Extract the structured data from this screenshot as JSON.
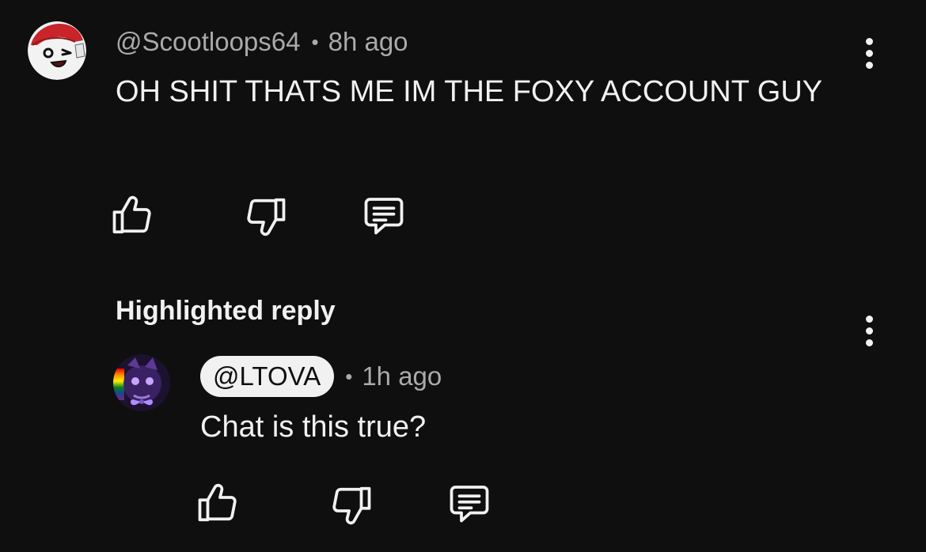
{
  "comment": {
    "author": "@Scootloops64",
    "separator": "•",
    "time": "8h ago",
    "text": "OH SHIT THATS ME IM THE FOXY ACCOUNT GUY",
    "actions": {
      "like_icon": "thumbs-up-icon",
      "dislike_icon": "thumbs-down-icon",
      "reply_icon": "reply-comment-icon"
    },
    "menu_icon": "more-vertical-icon"
  },
  "highlighted_reply": {
    "label": "Highlighted reply",
    "author": "@LTOVA",
    "separator": "•",
    "time": "1h ago",
    "text": "Chat is this true?",
    "actions": {
      "like_icon": "thumbs-up-icon",
      "dislike_icon": "thumbs-down-icon",
      "reply_icon": "reply-comment-icon"
    },
    "menu_icon": "more-vertical-icon"
  },
  "colors": {
    "background": "#0f0f0f",
    "text_primary": "#f1f1f1",
    "text_secondary": "#aaaaaa",
    "author_pill_bg": "#f1f1f1"
  }
}
